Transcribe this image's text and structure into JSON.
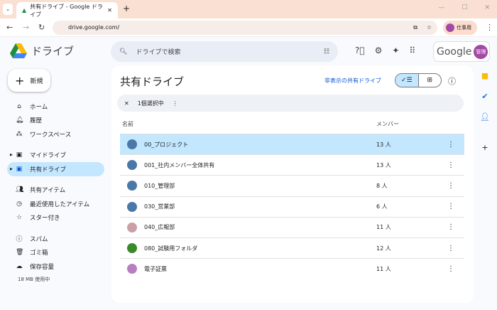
{
  "browser": {
    "tab_title": "共有ドライブ - Google ドライブ",
    "url": "drive.google.com/",
    "profile": "仕事用"
  },
  "app": {
    "name": "ドライブ",
    "search_placeholder": "ドライブで検索",
    "account_brand": "Google",
    "avatar_text": "管理"
  },
  "new_button": "新規",
  "sidebar": {
    "items": [
      {
        "label": "ホーム",
        "icon": "home-icon"
      },
      {
        "label": "履歴",
        "icon": "bell-icon"
      },
      {
        "label": "ワークスペース",
        "icon": "workspace-icon"
      },
      {
        "label": "マイドライブ",
        "icon": "my-drive-icon"
      },
      {
        "label": "共有ドライブ",
        "icon": "shared-drive-icon",
        "active": true
      },
      {
        "label": "共有アイテム",
        "icon": "people-icon"
      },
      {
        "label": "最近使用したアイテム",
        "icon": "clock-icon"
      },
      {
        "label": "スター付き",
        "icon": "star-icon"
      },
      {
        "label": "スパム",
        "icon": "spam-icon"
      },
      {
        "label": "ゴミ箱",
        "icon": "trash-icon"
      },
      {
        "label": "保存容量",
        "icon": "cloud-icon"
      }
    ],
    "usage": "18 MB 使用中"
  },
  "main": {
    "title": "共有ドライブ",
    "hidden_link": "非表示の共有ドライブ",
    "selection": "1個選択中",
    "columns": {
      "name": "名前",
      "members": "メンバー"
    },
    "rows": [
      {
        "name": "00_プロジェクト",
        "members": "13 人",
        "selected": true,
        "color": "#4a78a8"
      },
      {
        "name": "001_社内メンバー全体共有",
        "members": "13 人",
        "color": "#4a78a8"
      },
      {
        "name": "010_管理部",
        "members": "8 人",
        "color": "#4a78a8"
      },
      {
        "name": "030_営業部",
        "members": "6 人",
        "color": "#4a78a8"
      },
      {
        "name": "040_広報部",
        "members": "11 人",
        "color": "#c9a0a8"
      },
      {
        "name": "080_試験用フォルダ",
        "members": "12 人",
        "color": "#3a8a2a"
      },
      {
        "name": "電子証票",
        "members": "11 人",
        "color": "#b87fc0"
      }
    ]
  }
}
